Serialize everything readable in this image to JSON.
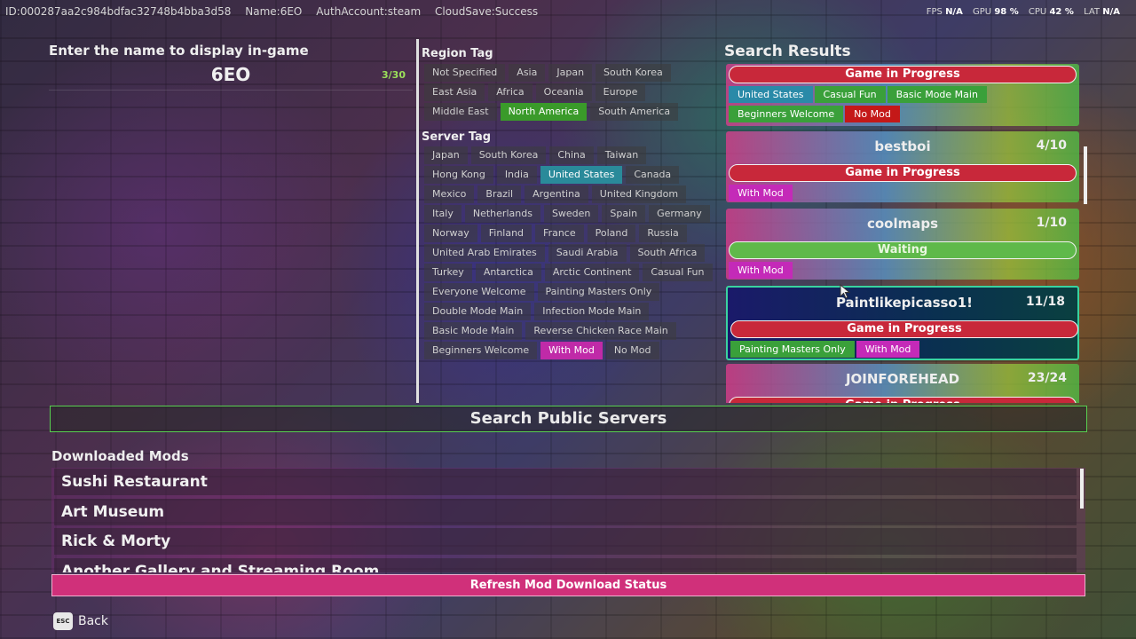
{
  "status_bar": {
    "id": "ID:000287aa2c984bdfac32748b4bba3d58",
    "name": "Name:6EO",
    "auth": "AuthAccount:steam",
    "cloud": "CloudSave:Success"
  },
  "perf": {
    "fps_label": "FPS",
    "fps_value": "N/A",
    "gpu_label": "GPU",
    "gpu_value": "98 %",
    "cpu_label": "CPU",
    "cpu_value": "42 %",
    "lat_label": "LAT",
    "lat_value": "N/A"
  },
  "name_entry": {
    "label": "Enter the name to display in-game",
    "value": "6EO",
    "count": "3/30"
  },
  "region_tags": {
    "title": "Region Tag",
    "items": [
      {
        "label": "Not Specified",
        "state": ""
      },
      {
        "label": "Asia",
        "state": ""
      },
      {
        "label": "Japan",
        "state": ""
      },
      {
        "label": "South Korea",
        "state": ""
      },
      {
        "label": "East Asia",
        "state": ""
      },
      {
        "label": "Africa",
        "state": ""
      },
      {
        "label": "Oceania",
        "state": ""
      },
      {
        "label": "Europe",
        "state": ""
      },
      {
        "label": "Middle East",
        "state": ""
      },
      {
        "label": "North America",
        "state": "sel-green"
      },
      {
        "label": "South America",
        "state": ""
      }
    ]
  },
  "server_tags": {
    "title": "Server Tag",
    "items": [
      {
        "label": "Japan",
        "state": ""
      },
      {
        "label": "South Korea",
        "state": ""
      },
      {
        "label": "China",
        "state": ""
      },
      {
        "label": "Taiwan",
        "state": ""
      },
      {
        "label": "Hong Kong",
        "state": ""
      },
      {
        "label": "India",
        "state": ""
      },
      {
        "label": "United States",
        "state": "sel-blue"
      },
      {
        "label": "Canada",
        "state": ""
      },
      {
        "label": "Mexico",
        "state": ""
      },
      {
        "label": "Brazil",
        "state": ""
      },
      {
        "label": "Argentina",
        "state": ""
      },
      {
        "label": "United Kingdom",
        "state": ""
      },
      {
        "label": "Italy",
        "state": ""
      },
      {
        "label": "Netherlands",
        "state": ""
      },
      {
        "label": "Sweden",
        "state": ""
      },
      {
        "label": "Spain",
        "state": ""
      },
      {
        "label": "Germany",
        "state": ""
      },
      {
        "label": "Norway",
        "state": ""
      },
      {
        "label": "Finland",
        "state": ""
      },
      {
        "label": "France",
        "state": ""
      },
      {
        "label": "Poland",
        "state": ""
      },
      {
        "label": "Russia",
        "state": ""
      },
      {
        "label": "United Arab Emirates",
        "state": ""
      },
      {
        "label": "Saudi Arabia",
        "state": ""
      },
      {
        "label": "South Africa",
        "state": ""
      },
      {
        "label": "Turkey",
        "state": ""
      },
      {
        "label": "Antarctica",
        "state": ""
      },
      {
        "label": "Arctic Continent",
        "state": ""
      },
      {
        "label": "Casual Fun",
        "state": ""
      },
      {
        "label": "Everyone Welcome",
        "state": ""
      },
      {
        "label": "Painting Masters Only",
        "state": ""
      },
      {
        "label": "Double Mode Main",
        "state": ""
      },
      {
        "label": "Infection Mode Main",
        "state": ""
      },
      {
        "label": "Basic Mode Main",
        "state": ""
      },
      {
        "label": "Reverse Chicken Race Main",
        "state": ""
      },
      {
        "label": "Beginners Welcome",
        "state": ""
      },
      {
        "label": "With Mod",
        "state": "sel-pink"
      },
      {
        "label": "No Mod",
        "state": ""
      }
    ]
  },
  "search_results": {
    "title": "Search Results",
    "cards": [
      {
        "name": "",
        "count": "",
        "status": "Game in Progress",
        "status_type": "progress",
        "tag_rows": [
          [
            {
              "label": "United States",
              "color": "blue"
            },
            {
              "label": "Casual Fun",
              "color": "green"
            },
            {
              "label": "Basic Mode Main",
              "color": "green"
            }
          ],
          [
            {
              "label": "Beginners Welcome",
              "color": "green"
            },
            {
              "label": "No Mod",
              "color": "red"
            }
          ]
        ]
      },
      {
        "name": "bestboi",
        "count": "4/10",
        "status": "Game in Progress",
        "status_type": "progress",
        "tag_rows": [
          [
            {
              "label": "With Mod",
              "color": "pink"
            }
          ]
        ]
      },
      {
        "name": "coolmaps",
        "count": "1/10",
        "status": "Waiting",
        "status_type": "waiting",
        "tag_rows": [
          [
            {
              "label": "With Mod",
              "color": "pink"
            }
          ]
        ]
      },
      {
        "name": "Paintlikepicasso1!",
        "count": "11/18",
        "status": "Game in Progress",
        "status_type": "progress",
        "selected": true,
        "tag_rows": [
          [
            {
              "label": "Painting Masters Only",
              "color": "green"
            },
            {
              "label": "With Mod",
              "color": "pink"
            }
          ]
        ]
      },
      {
        "name": "JOINFOREHEAD",
        "count": "23/24",
        "status": "Game in Progress",
        "status_type": "progress",
        "tag_rows": []
      }
    ]
  },
  "search_button": "Search Public Servers",
  "mods": {
    "title": "Downloaded Mods",
    "items": [
      "Sushi Restaurant",
      "Art Museum",
      "Rick & Morty",
      "Another Gallery and Streaming Room"
    ],
    "refresh_label": "Refresh Mod Download Status"
  },
  "back": {
    "key": "ESC",
    "label": "Back"
  }
}
